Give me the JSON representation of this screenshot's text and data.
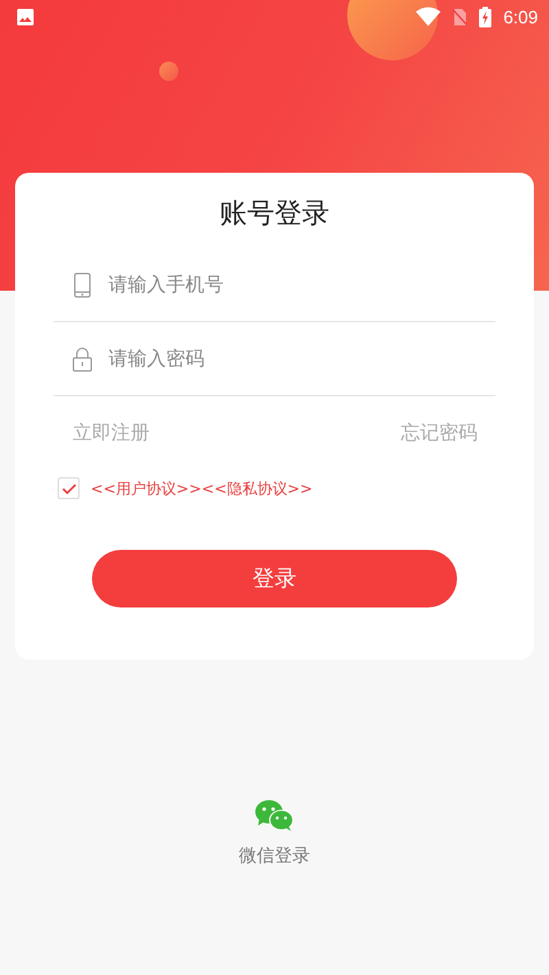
{
  "status_bar": {
    "time": "6:09"
  },
  "login_card": {
    "title": "账号登录",
    "fields": [
      {
        "kind": "phone",
        "placeholder": "请输入手机号"
      },
      {
        "kind": "password",
        "placeholder": "请输入密码"
      }
    ],
    "register_link": "立即注册",
    "forgot_link": "忘记密码",
    "agreement": {
      "checked": true,
      "links": [
        "<<用户协议>>",
        "<<隐私协议>>"
      ]
    },
    "login_button": "登录"
  },
  "wechat_login": {
    "label": "微信登录"
  }
}
